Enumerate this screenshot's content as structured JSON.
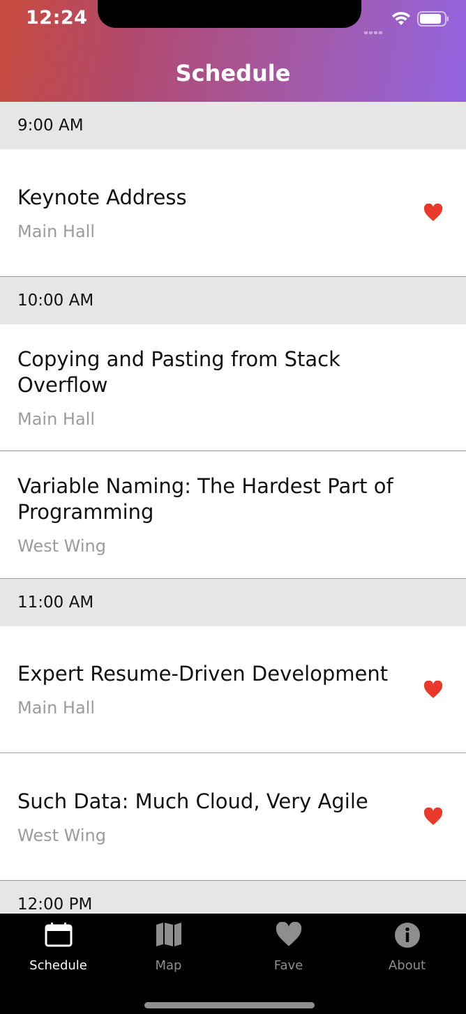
{
  "status_bar": {
    "time": "12:24"
  },
  "nav": {
    "title": "Schedule"
  },
  "colors": {
    "heart": "#e8392a",
    "section_bg": "#e6e6e6",
    "gradient_start": "#c74a3c",
    "gradient_end": "#9364e0"
  },
  "sections": [
    {
      "time": "9:00 AM",
      "sessions": [
        {
          "title": "Keynote Address",
          "location": "Main Hall",
          "favorite": true
        }
      ]
    },
    {
      "time": "10:00 AM",
      "sessions": [
        {
          "title": "Copying and Pasting from Stack Overflow",
          "location": "Main Hall",
          "favorite": false
        },
        {
          "title": "Variable Naming: The Hardest Part of Programming",
          "location": "West Wing",
          "favorite": false
        }
      ]
    },
    {
      "time": "11:00 AM",
      "sessions": [
        {
          "title": "Expert Resume-Driven Development",
          "location": "Main Hall",
          "favorite": true
        },
        {
          "title": "Such Data: Much Cloud, Very Agile",
          "location": "West Wing",
          "favorite": true
        }
      ]
    },
    {
      "time": "12:00 PM",
      "sessions": []
    }
  ],
  "tabs": [
    {
      "label": "Schedule",
      "icon": "calendar-icon",
      "active": true
    },
    {
      "label": "Map",
      "icon": "map-icon",
      "active": false
    },
    {
      "label": "Fave",
      "icon": "heart-icon",
      "active": false
    },
    {
      "label": "About",
      "icon": "info-icon",
      "active": false
    }
  ]
}
